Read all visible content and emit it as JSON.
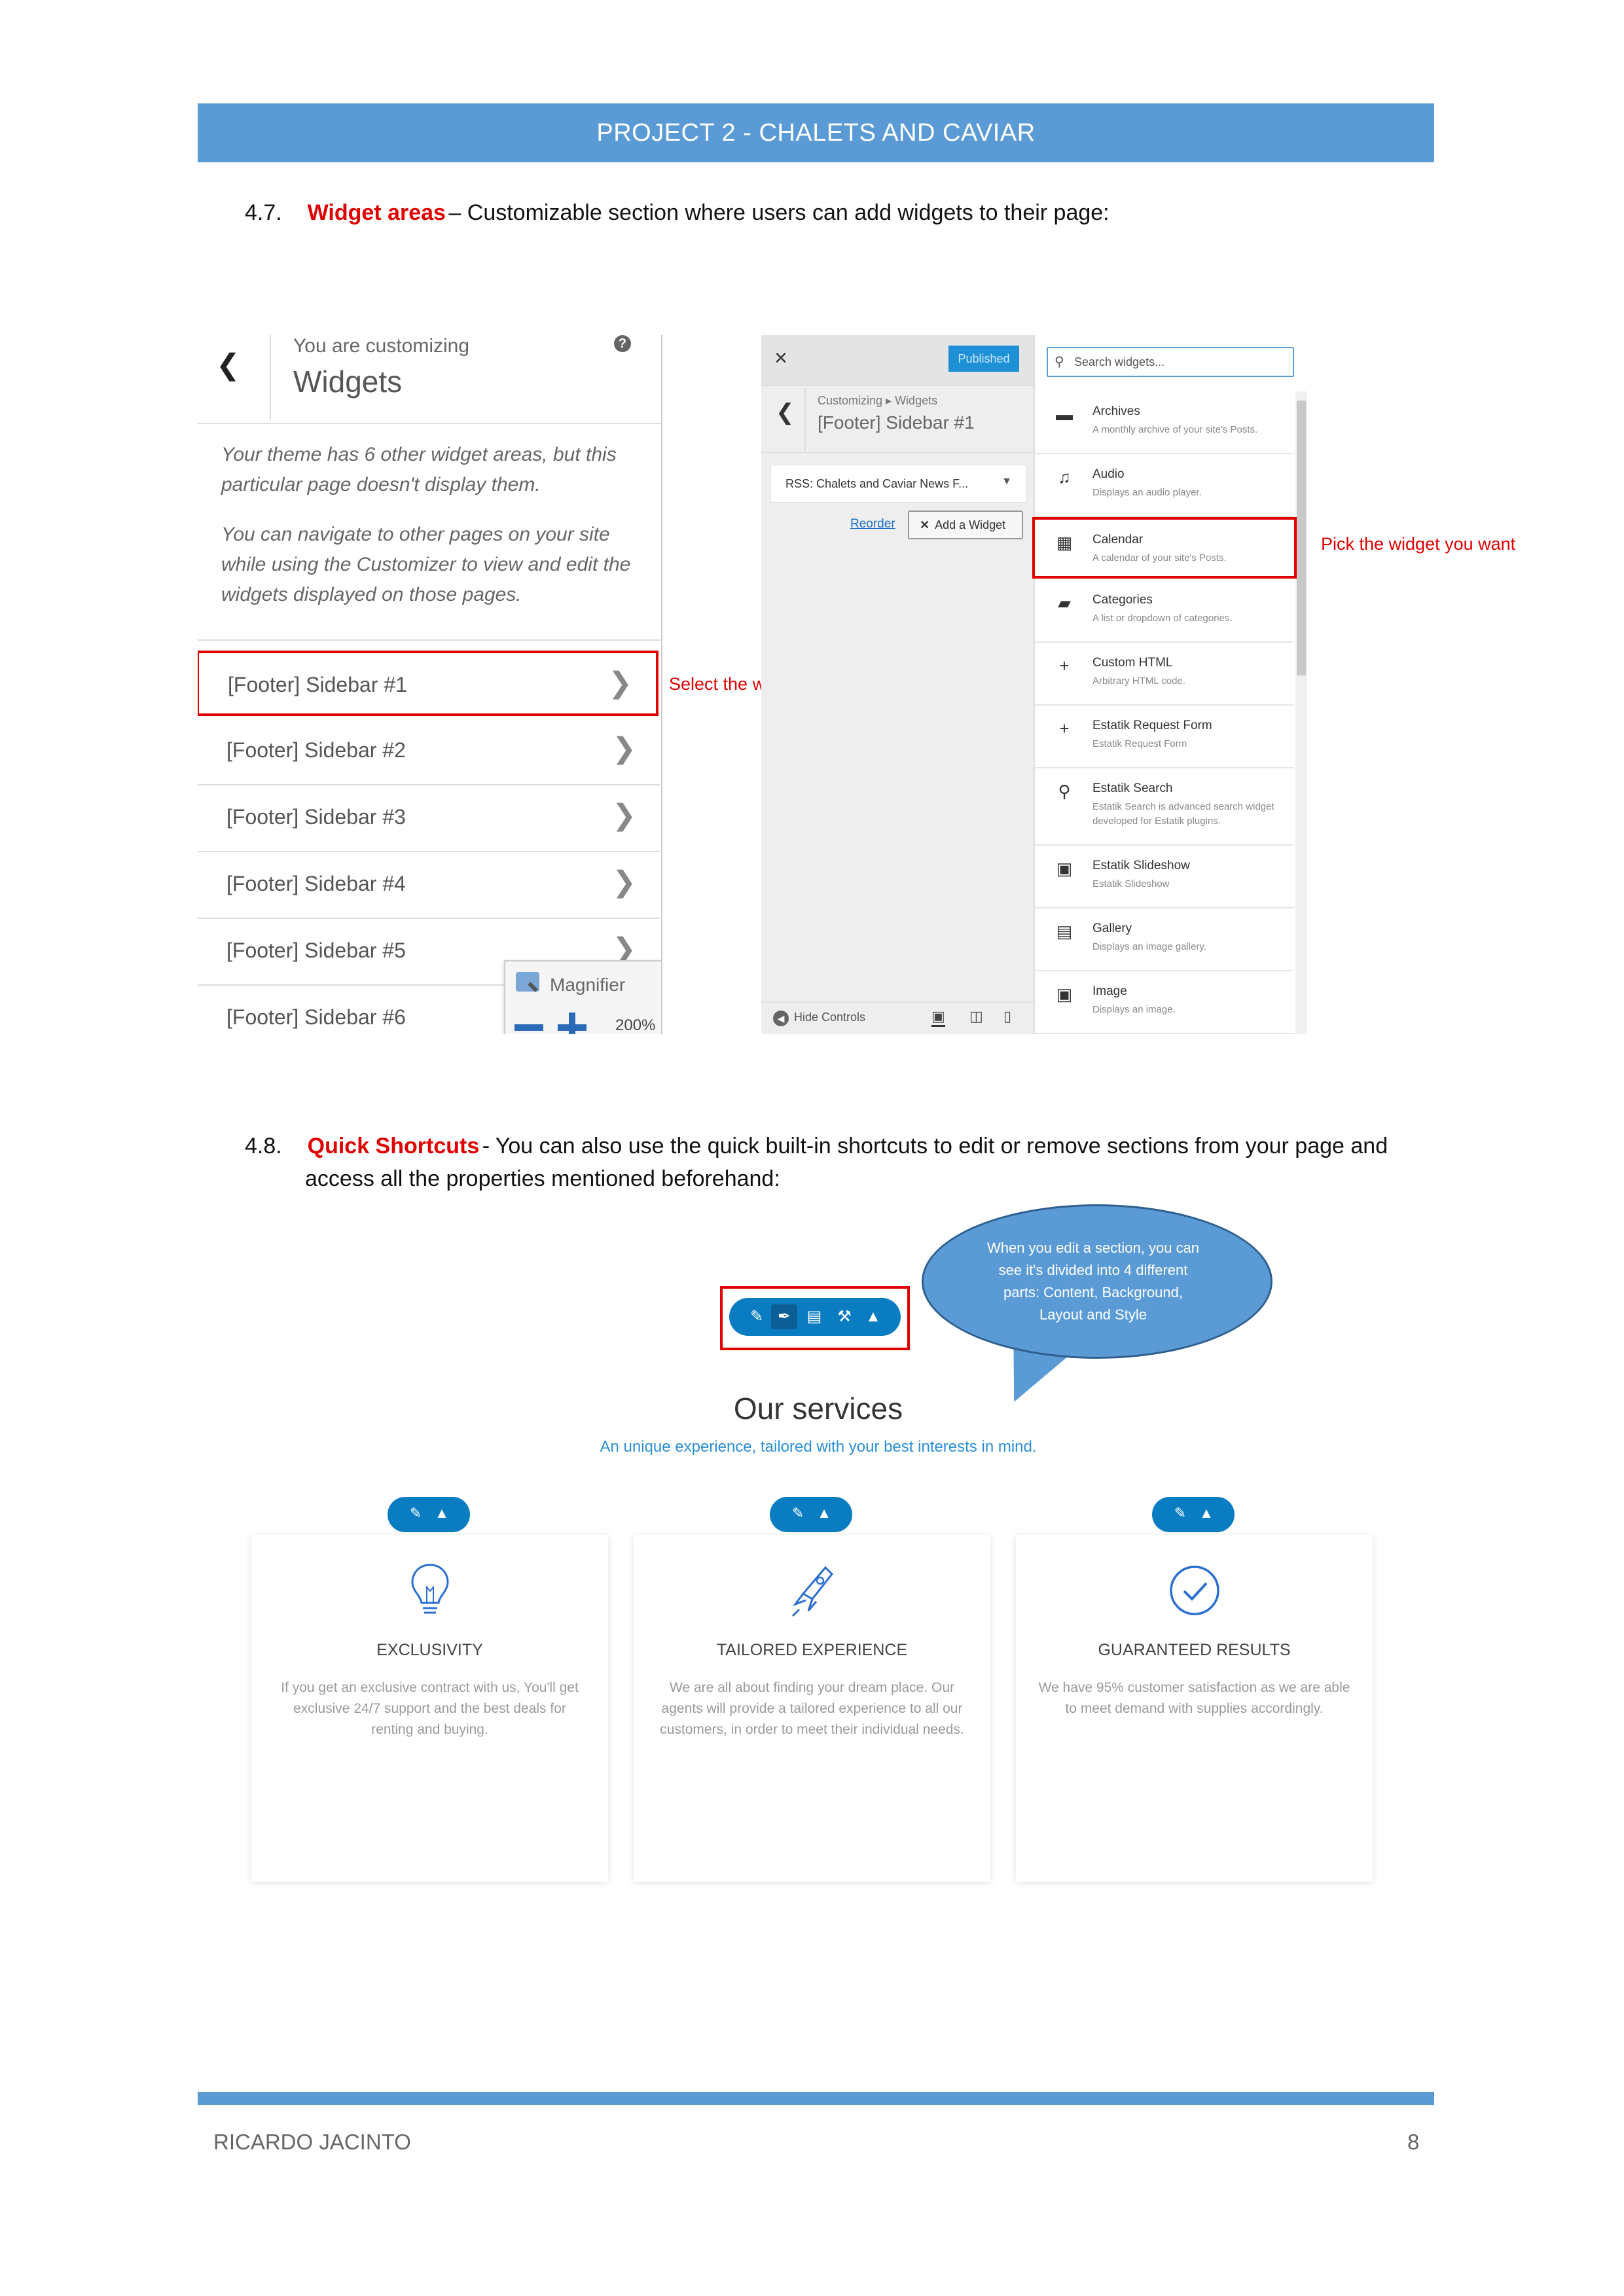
{
  "header": {
    "title": "PROJECT 2 - CHALETS AND CAVIAR"
  },
  "section_47": {
    "number": "4.7.",
    "title": "Widget areas",
    "text": "– Customizable section where users can add widgets to their page:"
  },
  "customizer": {
    "back_icon": "chevron-left",
    "you_are_customizing": "You are customizing",
    "title": "Widgets",
    "help_icon": "?",
    "note1": "Your theme has 6 other widget areas, but this particular page doesn't display them.",
    "note2": "You can navigate to other pages on your site while using the Customizer to view and edit the widgets displayed on those pages.",
    "sidebars": [
      "[Footer] Sidebar #1",
      "[Footer] Sidebar #2",
      "[Footer] Sidebar #3",
      "[Footer] Sidebar #4",
      "[Footer] Sidebar #5",
      "[Footer] Sidebar #6"
    ],
    "magnifier": {
      "label": "Magnifier",
      "zoom": "200%"
    }
  },
  "annotations": {
    "select_area": "Select the widget area you want to edit",
    "pick_widget": "Pick the widget you want"
  },
  "widget_panel": {
    "close": "×",
    "published": "Published",
    "breadcrumb": "Customizing ▸ Widgets",
    "area_title": "[Footer] Sidebar #1",
    "rss_item": "RSS: Chalets and Caviar News F...",
    "reorder": "Reorder",
    "add_widget": "Add a Widget",
    "hide_controls": "Hide Controls",
    "search_placeholder": "Search widgets...",
    "widgets": [
      {
        "icon": "archive-icon",
        "glyph": "▬",
        "title": "Archives",
        "desc": "A monthly archive of your site's Posts."
      },
      {
        "icon": "audio-icon",
        "glyph": "♫",
        "title": "Audio",
        "desc": "Displays an audio player."
      },
      {
        "icon": "calendar-icon",
        "glyph": "▦",
        "title": "Calendar",
        "desc": "A calendar of your site's Posts."
      },
      {
        "icon": "folder-icon",
        "glyph": "▰",
        "title": "Categories",
        "desc": "A list or dropdown of categories."
      },
      {
        "icon": "plus-icon",
        "glyph": "+",
        "title": "Custom HTML",
        "desc": "Arbitrary HTML code."
      },
      {
        "icon": "plus-icon",
        "glyph": "+",
        "title": "Estatik Request Form",
        "desc": "Estatik Request Form"
      },
      {
        "icon": "search-icon",
        "glyph": "⚲",
        "title": "Estatik Search",
        "desc": "Estatik Search is advanced search widget developed for Estatik plugins."
      },
      {
        "icon": "image-icon",
        "glyph": "▣",
        "title": "Estatik Slideshow",
        "desc": "Estatik Slideshow"
      },
      {
        "icon": "gallery-icon",
        "glyph": "▤",
        "title": "Gallery",
        "desc": "Displays an image gallery."
      },
      {
        "icon": "image-icon",
        "glyph": "▣",
        "title": "Image",
        "desc": "Displays an image."
      }
    ]
  },
  "section_48": {
    "number": "4.8.",
    "title": "Quick Shortcuts",
    "text1": "- You can also use the quick built-in shortcuts to edit or remove sections from your page and",
    "text2": "access all the properties mentioned beforehand:"
  },
  "bubble": {
    "text": "When you edit a section, you can see it's divided into 4 different parts: Content, Background, Layout and Style"
  },
  "services": {
    "title": "Our services",
    "subtitle": "An unique experience, tailored with your best interests in mind.",
    "cards": [
      {
        "icon": "lightbulb-icon",
        "title": "EXCLUSIVITY",
        "body": "If you get an exclusive contract with us, You'll get exclusive 24/7 support and the best deals for renting and buying."
      },
      {
        "icon": "rocket-icon",
        "title": "TAILORED EXPERIENCE",
        "body": "We are all about finding your dream place. Our agents will provide a tailored experience to all our customers, in order to meet their individual needs."
      },
      {
        "icon": "check-circle-icon",
        "title": "GUARANTEED RESULTS",
        "body": "We have 95% customer satisfaction as we are able to meet demand with supplies accordingly."
      }
    ]
  },
  "footer": {
    "author": "RICARDO JACINTO",
    "page": "8"
  },
  "colors": {
    "header": "#5b9bd5",
    "accent_red": "#e00000",
    "pill_blue": "#0a7cc2",
    "subtitle_blue": "#2a8fd6"
  }
}
